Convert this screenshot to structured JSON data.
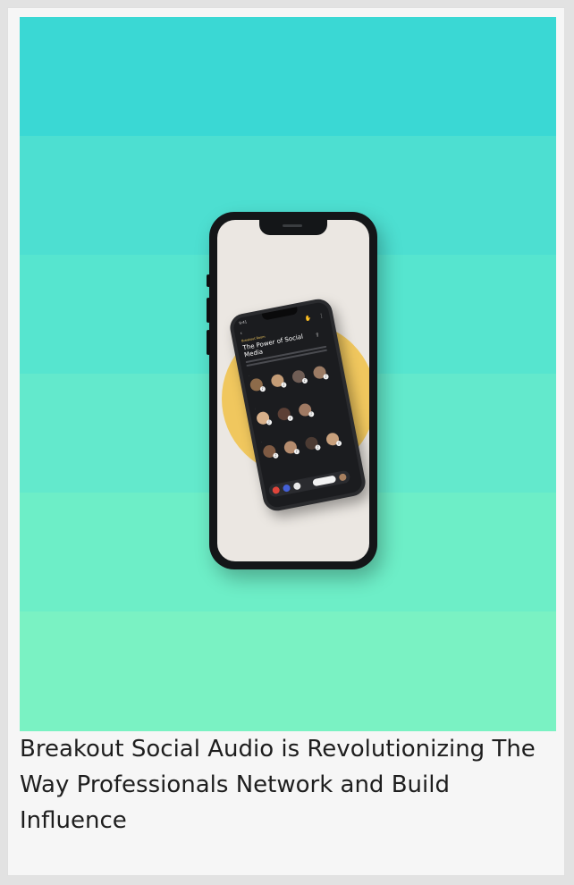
{
  "hero": {
    "band_colors": [
      "#3ad8d4",
      "#4ddfd1",
      "#56e5cf",
      "#63e9cc",
      "#6deec7",
      "#7af2c3"
    ],
    "circle_color": "#f0c75e",
    "phone_image_alt": "Phone showing Breakout social audio room"
  },
  "caption": {
    "text": "Breakout Social Audio is Revolutionizing The Way Professionals Network and Build Influence"
  },
  "app_mockup": {
    "time": "9:41",
    "club_label": "Breakout Room",
    "room_title": "The Power of Social Media"
  }
}
